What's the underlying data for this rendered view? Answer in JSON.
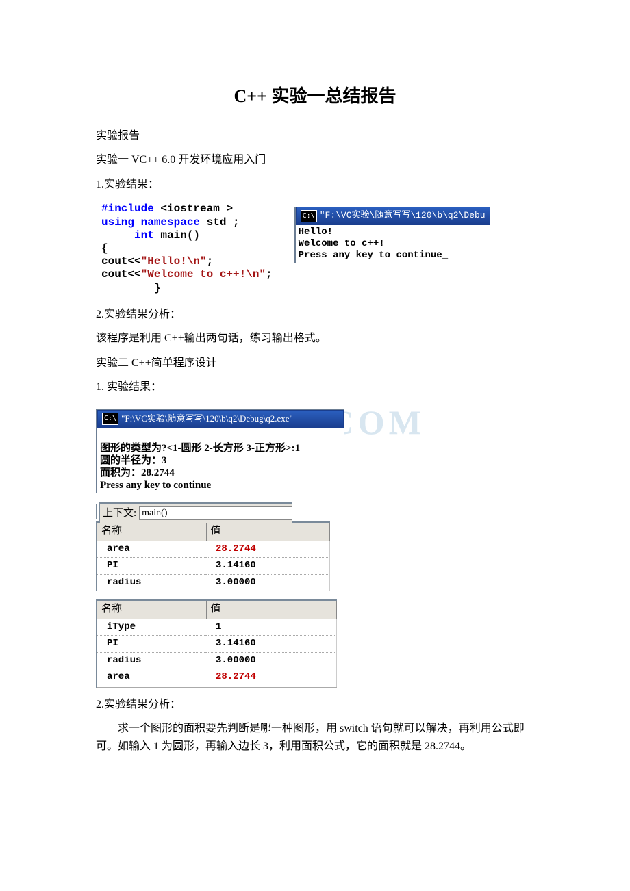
{
  "title": "C++ 实验一总结报告",
  "p1": "实验报告",
  "p2": "实验一 VC++ 6.0 开发环境应用入门",
  "p3": "1.实验结果：",
  "code1": {
    "l1a": "#include ",
    "l1b": "<iostream >",
    "l2a": "using namespace ",
    "l2b": "std ;",
    "l3a": "     int",
    "l3b": " main()",
    "l4": "{",
    "l5a": "cout<<",
    "l5b": "\"Hello!\\n\"",
    "l5c": ";",
    "l6a": "cout<<",
    "l6b": "\"Welcome to c++!\\n\"",
    "l6c": ";",
    "l7": "        }"
  },
  "console1": {
    "title": "\"F:\\VC实验\\随意写写\\120\\b\\q2\\Debu",
    "out": "Hello!\nWelcome to c++!\nPress any key to continue_"
  },
  "p4": "2.实验结果分析：",
  "p5": "该程序是利用 C++输出两句话，练习输出格式。",
  "p6": "实验二 C++简单程序设计",
  "p7": "1. 实验结果：",
  "watermark": "X.COM",
  "console2": {
    "title": "\"F:\\VC实验\\随意写写\\120\\b\\q2\\Debug\\q2.exe\"",
    "out_l1": "图形的类型为?<1-圆形 2-长方形 3-正方形>:1",
    "out_l2": "圆的半径为：3",
    "out_l3": "面积为：28.2744",
    "out_l4": "Press any key to continue"
  },
  "context": {
    "label": "上下文:",
    "value": "main()"
  },
  "table1": {
    "h1": "名称",
    "h2": "值",
    "rows": [
      {
        "name": "area",
        "value": "28.2744",
        "cls": "red"
      },
      {
        "name": "PI",
        "value": "3.14160",
        "cls": ""
      },
      {
        "name": "radius",
        "value": "3.00000",
        "cls": ""
      }
    ]
  },
  "table2": {
    "h1": "名称",
    "h2": "值",
    "rows": [
      {
        "name": "iType",
        "value": "1",
        "cls": ""
      },
      {
        "name": "PI",
        "value": "3.14160",
        "cls": ""
      },
      {
        "name": "radius",
        "value": "3.00000",
        "cls": ""
      },
      {
        "name": "area",
        "value": "28.2744",
        "cls": "red"
      },
      {
        "name": "",
        "value": "",
        "cls": ""
      }
    ]
  },
  "p8": "2.实验结果分析：",
  "p9": "求一个图形的面积要先判断是哪一种图形，用 switch 语句就可以解决，再利用公式即可。如输入 1 为圆形，再输入边长 3，利用面积公式，它的面积就是 28.2744。"
}
